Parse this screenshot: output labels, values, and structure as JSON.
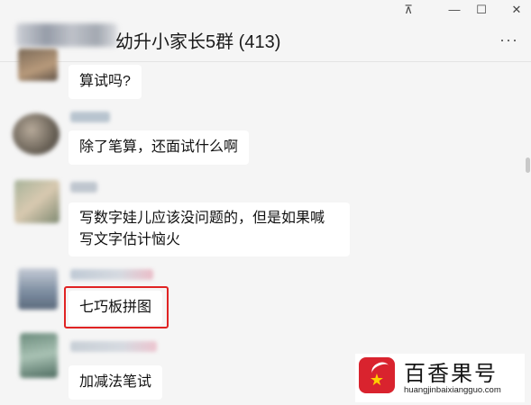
{
  "window": {
    "pin_icon": "⊼",
    "minimize_icon": "—",
    "maximize_icon": "☐",
    "close_icon": "✕"
  },
  "header": {
    "title": "幼升小家长5群 (413)",
    "more_icon": "···"
  },
  "messages": [
    {
      "text": "算试吗?"
    },
    {
      "text": "除了笔算，还面试什么啊"
    },
    {
      "text": "写数字娃儿应该没问题的，但是如果喊\n写文字估计恼火"
    },
    {
      "text": "七巧板拼图",
      "highlighted": true
    },
    {
      "text": "加减法笔试"
    }
  ],
  "watermark": {
    "name": "百香果号",
    "url": "huangjinbaixiangguo.com",
    "accent_color": "#d9232e"
  }
}
